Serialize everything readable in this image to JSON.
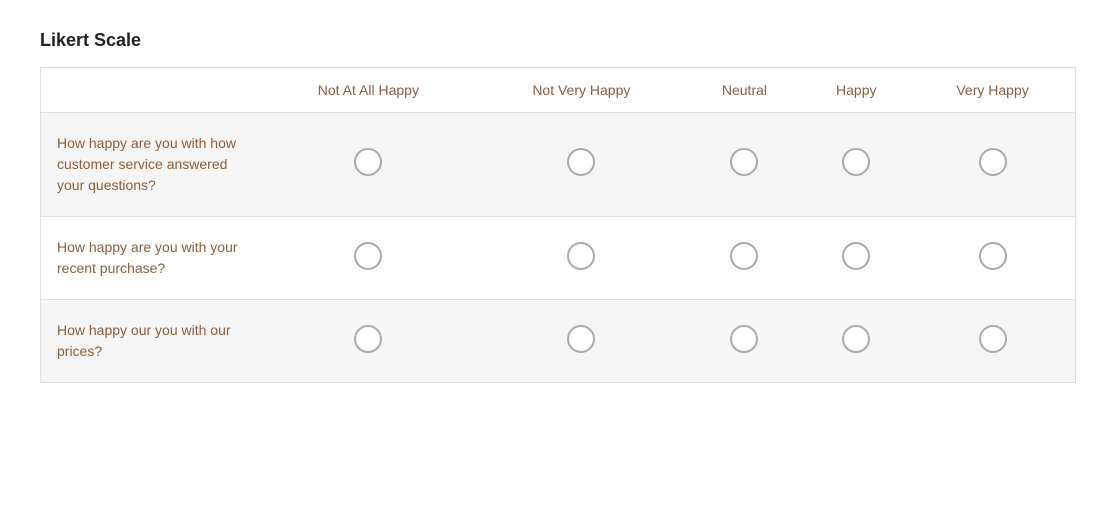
{
  "title": "Likert Scale",
  "columns": {
    "question_label": "",
    "col1": "Not At All Happy",
    "col2": "Not Very Happy",
    "col3": "Neutral",
    "col4": "Happy",
    "col5": "Very Happy"
  },
  "rows": [
    {
      "id": "row1",
      "question": "How happy are you with how customer service answered your questions?"
    },
    {
      "id": "row2",
      "question": "How happy are you with your recent purchase?"
    },
    {
      "id": "row3",
      "question": "How happy our you with our prices?"
    }
  ]
}
